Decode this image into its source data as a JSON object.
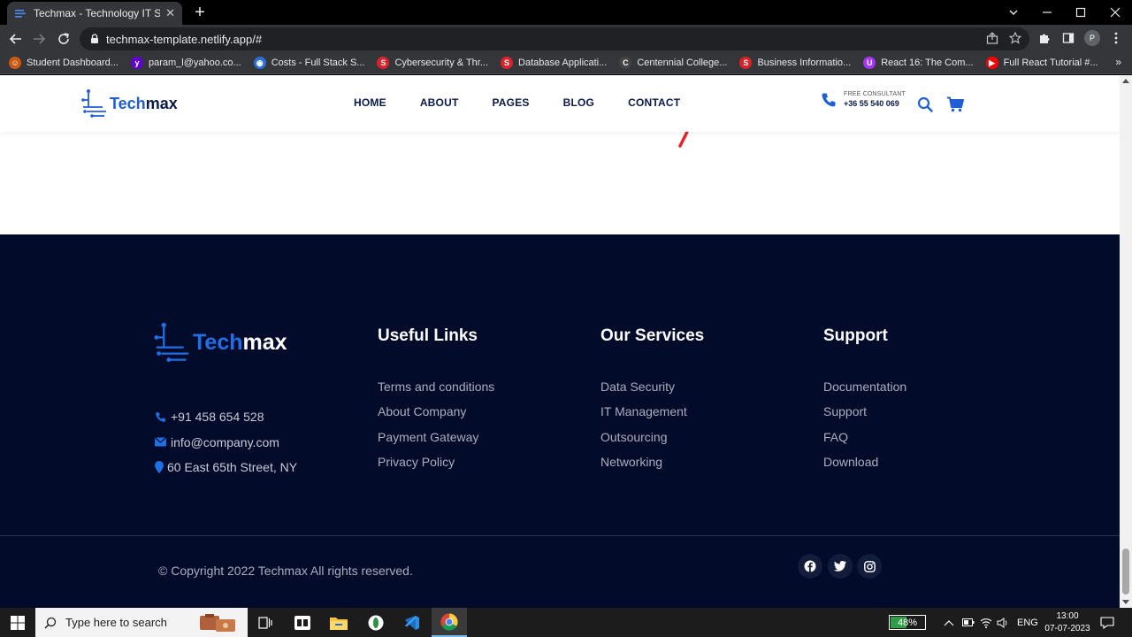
{
  "browser": {
    "tab_title": "Techmax - Technology IT Solution",
    "url": "techmax-template.netlify.app/#",
    "bookmarks": [
      {
        "label": "Student Dashboard...",
        "icon": "student-icon",
        "color": "#c85a12"
      },
      {
        "label": "param_l@yahoo.co...",
        "icon": "yahoo-icon",
        "color": "#6001d2"
      },
      {
        "label": "Costs - Full Stack S...",
        "icon": "globe-icon",
        "color": "#2a6fd8"
      },
      {
        "label": "Cybersecurity & Thr...",
        "icon": "s-logo-icon",
        "color": "#d8232a"
      },
      {
        "label": "Database Applicati...",
        "icon": "s-logo-icon",
        "color": "#d8232a"
      },
      {
        "label": "Centennial College...",
        "icon": "c-logo-icon",
        "color": "#444444"
      },
      {
        "label": "Business Informatio...",
        "icon": "s-logo-icon",
        "color": "#d8232a"
      },
      {
        "label": "React 16: The Com...",
        "icon": "udemy-icon",
        "color": "#a435f0"
      },
      {
        "label": "Full React Tutorial #...",
        "icon": "youtube-icon",
        "color": "#ff0000"
      }
    ]
  },
  "header": {
    "logo_tech": "Tech",
    "logo_max": "max",
    "nav": [
      "HOME",
      "ABOUT",
      "PAGES",
      "BLOG",
      "CONTACT"
    ],
    "consult_label": "FREE CONSULTANT",
    "consult_phone": "+36 55 540 069"
  },
  "footer": {
    "logo_tech": "Tech",
    "logo_max": "max",
    "contacts": [
      {
        "icon": "phone-icon",
        "text": "+91 458 654 528"
      },
      {
        "icon": "envelope-icon",
        "text": "info@company.com"
      },
      {
        "icon": "map-pin-icon",
        "text": "60 East 65th Street, NY"
      }
    ],
    "columns": [
      {
        "title": "Useful Links",
        "links": [
          "Terms and conditions",
          "About Company",
          "Payment Gateway",
          "Privacy Policy"
        ]
      },
      {
        "title": "Our Services",
        "links": [
          "Data Security",
          "IT Management",
          "Outsourcing",
          "Networking"
        ]
      },
      {
        "title": "Support",
        "links": [
          "Documentation",
          "Support",
          "FAQ",
          "Download"
        ]
      }
    ],
    "copyright": "© Copyright 2022 Techmax All rights reserved.",
    "socials": [
      "facebook-icon",
      "twitter-icon",
      "instagram-icon"
    ]
  },
  "taskbar": {
    "search_placeholder": "Type here to search",
    "battery": "48%",
    "battery_level": 0.48,
    "lang": "ENG",
    "time": "13:00",
    "date": "07-07-2023"
  },
  "colors": {
    "brand_blue": "#1f5fd6",
    "navy": "#0a1a4a",
    "footer_bg": "#030b2a"
  }
}
